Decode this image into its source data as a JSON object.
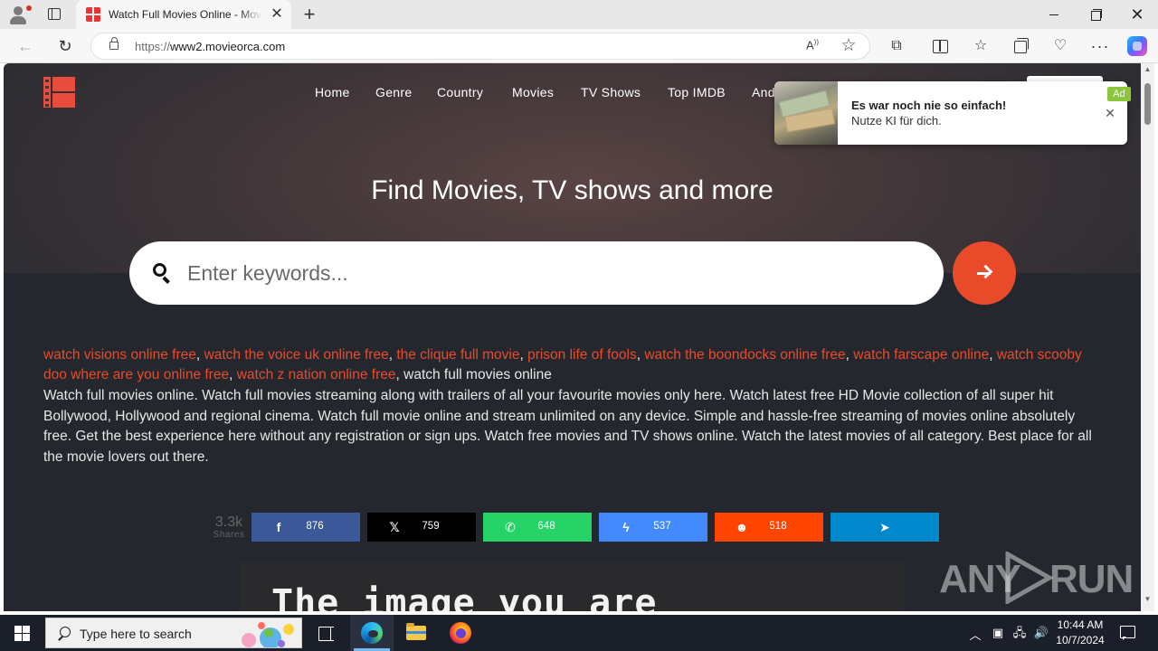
{
  "browser": {
    "tab_title": "Watch Full Movies Online - Movieorca",
    "tab_close": "✕",
    "new_tab": "+",
    "url_prefix": "https://",
    "url_host": "www2.movieorca.com",
    "menu": "···"
  },
  "site": {
    "nav": [
      "Home",
      "Genre",
      "Country",
      "Movies",
      "TV Shows",
      "Top IMDB",
      "And"
    ],
    "hero_title": "Find Movies, TV shows and more",
    "search_placeholder": "Enter keywords...",
    "tag_links": [
      "watch visions online free",
      "watch the voice uk online free",
      "the clique full movie",
      "prison life of fools",
      "watch the boondocks online free",
      "watch farscape online",
      "watch scooby doo where are you online free",
      "watch z nation online free"
    ],
    "tag_tail": "watch full movies online",
    "description": "Watch full movies online. Watch full movies streaming along with trailers of all your favourite movies only here. Watch latest free HD Movie collection of all super hit Bollywood, Hollywood and regional cinema. Watch full movie online and stream unlimited on any device. Simple and hassle-free streaming of movies online absolutely free. Get the best experience here without any registration or sign ups. Watch free movies and TV shows online. Watch the latest movies of all category. Best place for all the movie lovers out there.",
    "share": {
      "total": "3.3k",
      "label": "Shares",
      "facebook": "876",
      "x": "759",
      "whatsapp": "648",
      "messenger": "537",
      "reddit": "518"
    },
    "image_panel_text": "The image you are"
  },
  "ad": {
    "title": "Es war noch nie so einfach!",
    "text": "Nutze KI für dich.",
    "badge": "Ad",
    "close": "✕"
  },
  "watermark": {
    "left": "ANY",
    "right": "RUN"
  },
  "taskbar": {
    "search_placeholder": "Type here to search",
    "time": "10:44 AM",
    "date": "10/7/2024"
  },
  "colors": {
    "accent": "#e94b2a",
    "page_bg": "#24272e",
    "facebook": "#3b5998",
    "x": "#000000",
    "whatsapp": "#25d366",
    "messenger": "#448aff",
    "reddit": "#ff4500",
    "telegram": "#0088cc"
  }
}
